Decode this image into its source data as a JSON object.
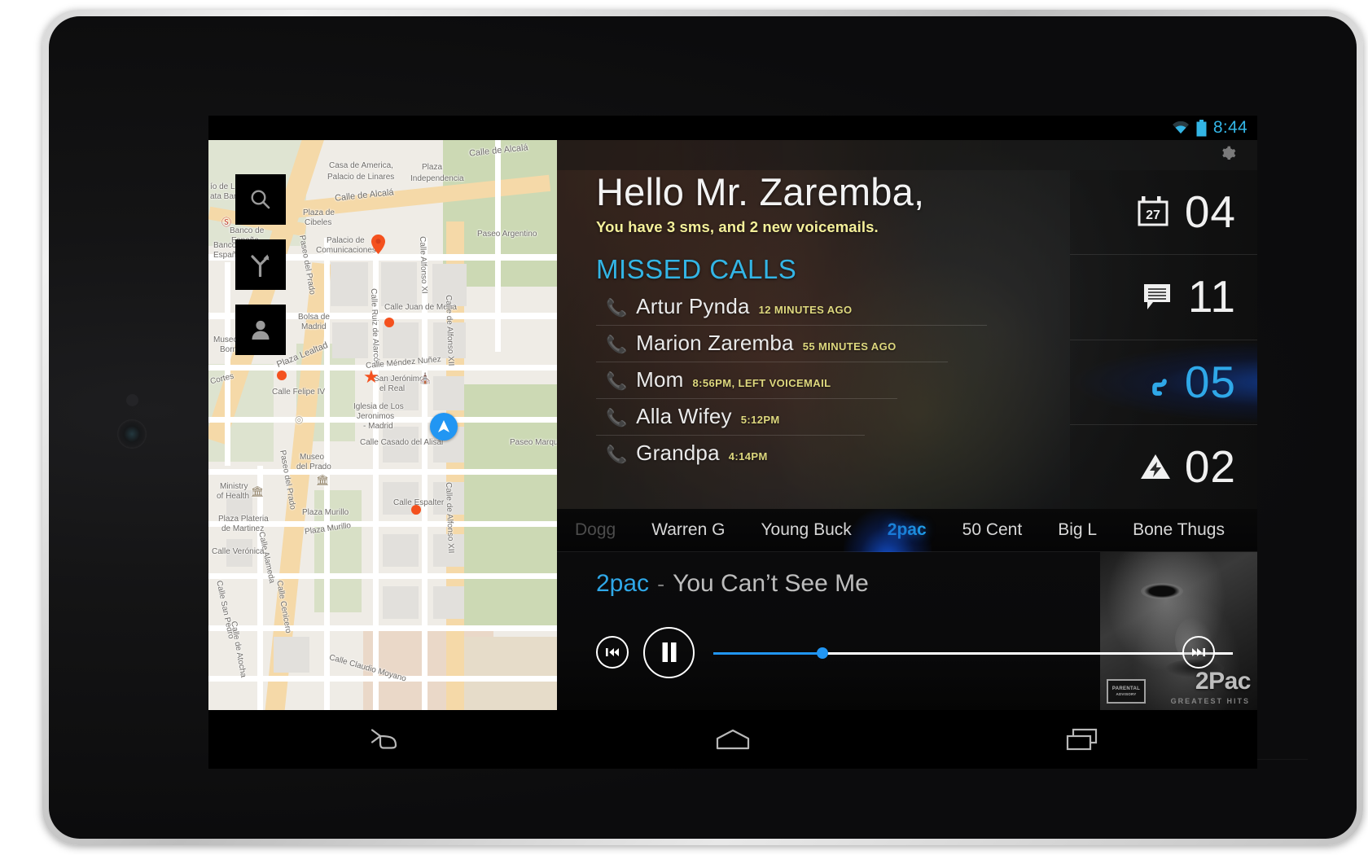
{
  "status_bar": {
    "time": "8:44",
    "wifi_icon": "wifi-icon",
    "battery_icon": "battery-icon",
    "accent": "#33b5e5"
  },
  "header": {
    "settings_icon": "gear-icon"
  },
  "greeting": {
    "title": "Hello Mr. Zaremba,",
    "subtitle": "You have 3 sms, and 2 new voicemails.",
    "subtitle_color": "#f5f09a"
  },
  "missed_calls": {
    "title": "MISSED CALLS",
    "title_color": "#33b5e5",
    "items": [
      {
        "icon": "phone-icon",
        "name": "Artur Pynda",
        "time": "12 MINUTES AGO"
      },
      {
        "icon": "phone-icon",
        "name": "Marion Zaremba",
        "time": "55 MINUTES AGO"
      },
      {
        "icon": "phone-icon",
        "name": "Mom",
        "time": "8:56PM, LEFT VOICEMAIL"
      },
      {
        "icon": "phone-icon",
        "name": "Alla Wifey",
        "time": "5:12PM"
      },
      {
        "icon": "phone-icon",
        "name": "Grandpa",
        "time": "4:14PM"
      }
    ]
  },
  "stats": [
    {
      "icon": "calendar-icon",
      "badge": "27",
      "value": "04",
      "accent": false
    },
    {
      "icon": "message-icon",
      "badge": "",
      "value": "11",
      "accent": false
    },
    {
      "icon": "phone-icon",
      "badge": "",
      "value": "05",
      "accent": true
    },
    {
      "icon": "warning-icon",
      "badge": "",
      "value": "02",
      "accent": false
    }
  ],
  "music": {
    "artist_tabs": [
      {
        "label": "Dogg",
        "state": "faded"
      },
      {
        "label": "Warren G",
        "state": "normal"
      },
      {
        "label": "Young Buck",
        "state": "normal"
      },
      {
        "label": "2pac",
        "state": "active"
      },
      {
        "label": "50 Cent",
        "state": "normal"
      },
      {
        "label": "Big L",
        "state": "normal"
      },
      {
        "label": "Bone Thugs",
        "state": "normal"
      }
    ],
    "now_playing": {
      "artist": "2pac",
      "separator": "-",
      "title": "You Can’t See Me"
    },
    "controls": {
      "previous_icon": "skip-previous-icon",
      "play_pause_icon": "pause-icon",
      "next_icon": "skip-next-icon"
    },
    "progress_percent": 21,
    "album_art": {
      "brand": "2Pac",
      "subtitle": "GREATEST HITS",
      "advisory_top": "PARENTAL",
      "advisory_bottom": "ADVISORY"
    },
    "accent": "#2fa8e8"
  },
  "map": {
    "buttons": [
      {
        "icon": "search-icon",
        "name": "map-search-button"
      },
      {
        "icon": "directions-icon",
        "name": "map-directions-button"
      },
      {
        "icon": "person-icon",
        "name": "map-person-button"
      }
    ],
    "labels": [
      "Casa de America,",
      "Palacio de Linares",
      "Plaza",
      "Independencia",
      "Calle de Alcalá",
      "Calle de Alcalá",
      "ío de L",
      "ata Ban",
      "Plaza de",
      "Cibeles",
      "Banco de",
      "España",
      "Banco de",
      "España",
      "Palacio de",
      "Comunicaciones",
      "Paseo del Prado",
      "Calle Alfonso XI",
      "Calle Ruiz de Alarcón",
      "Calle Juan de Mena",
      "Paseo Argentino",
      "Bolsa de",
      "Madrid",
      "Museo Thyssen",
      "Bornemisza",
      "Plaza Lealtad",
      "Cortes",
      "Calle Felipe IV",
      "Calle Méndez Nuñez",
      "San Jerónimo",
      "el Real",
      "Iglesia de Los",
      "Jeronimos",
      "- Madrid",
      "Calle Casado del Alisal",
      "Calle de Alfonso XII",
      "Museo",
      "del Prado",
      "Paseo Marques",
      "Ministry",
      "of Health",
      "Plaza Murillo",
      "Plaza Murillo",
      "Plaza Plateria",
      "de Martinez",
      "Calle Espalter",
      "Calle Verónica",
      "Calle Alameda",
      "Calle San Pedro",
      "Calle Cenicero",
      "Calle de Atocha",
      "Calle Claudio Moyano",
      "Paseo del Prado",
      "Calle de Alfonso XII"
    ]
  },
  "navbar": {
    "back_icon": "back-icon",
    "home_icon": "home-icon",
    "recents_icon": "recents-icon"
  }
}
